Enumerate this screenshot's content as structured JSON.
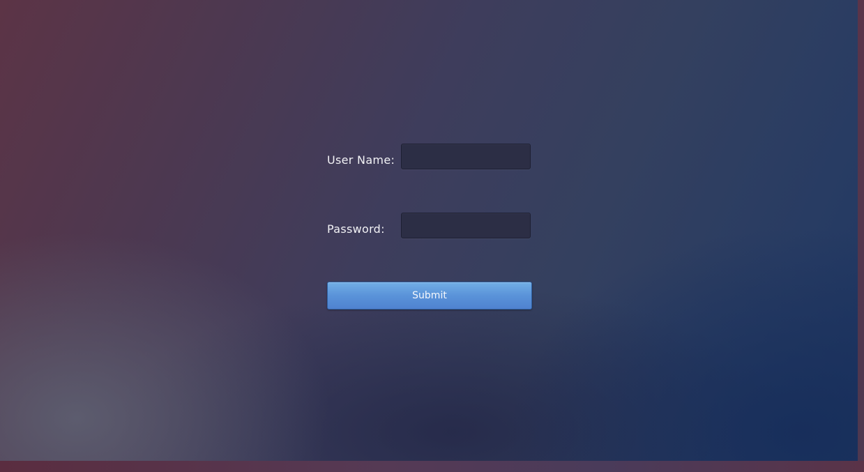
{
  "login_form": {
    "username_label": "User Name:",
    "username_value": "",
    "password_label": "Password:",
    "password_value": "",
    "submit_label": "Submit"
  },
  "colors": {
    "submit_button": "#5a93d9",
    "field_background": "#2c2e45",
    "label_text": "#f2f2f5"
  }
}
